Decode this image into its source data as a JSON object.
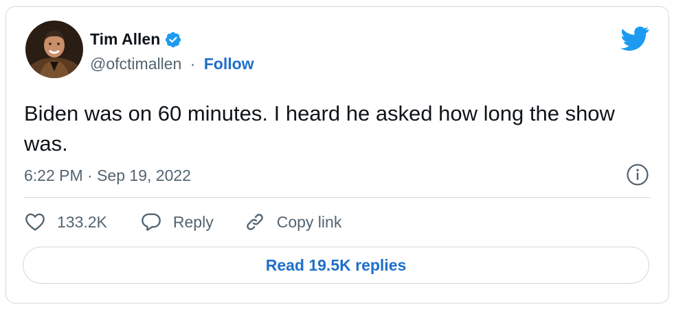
{
  "author": {
    "name": "Tim Allen",
    "handle": "@ofctimallen",
    "separator": "·",
    "follow_label": "Follow",
    "verified": true
  },
  "tweet": {
    "text": "Biden was on 60 minutes. I heard he asked how long the show was.",
    "timestamp": "6:22 PM · Sep 19, 2022"
  },
  "actions": {
    "like_count": "133.2K",
    "reply_label": "Reply",
    "copy_link_label": "Copy link"
  },
  "read_replies_label": "Read 19.5K replies",
  "icons": {
    "brand": "twitter-bird-icon",
    "verified": "verified-badge-icon",
    "info": "info-icon",
    "like": "heart-icon",
    "reply": "reply-bubble-icon",
    "copy_link": "link-icon"
  },
  "colors": {
    "twitter_blue": "#1d9bf0",
    "link_blue": "#1d6fc9",
    "text_primary": "#0f1419",
    "text_secondary": "#536471",
    "border": "#cfd9de"
  }
}
